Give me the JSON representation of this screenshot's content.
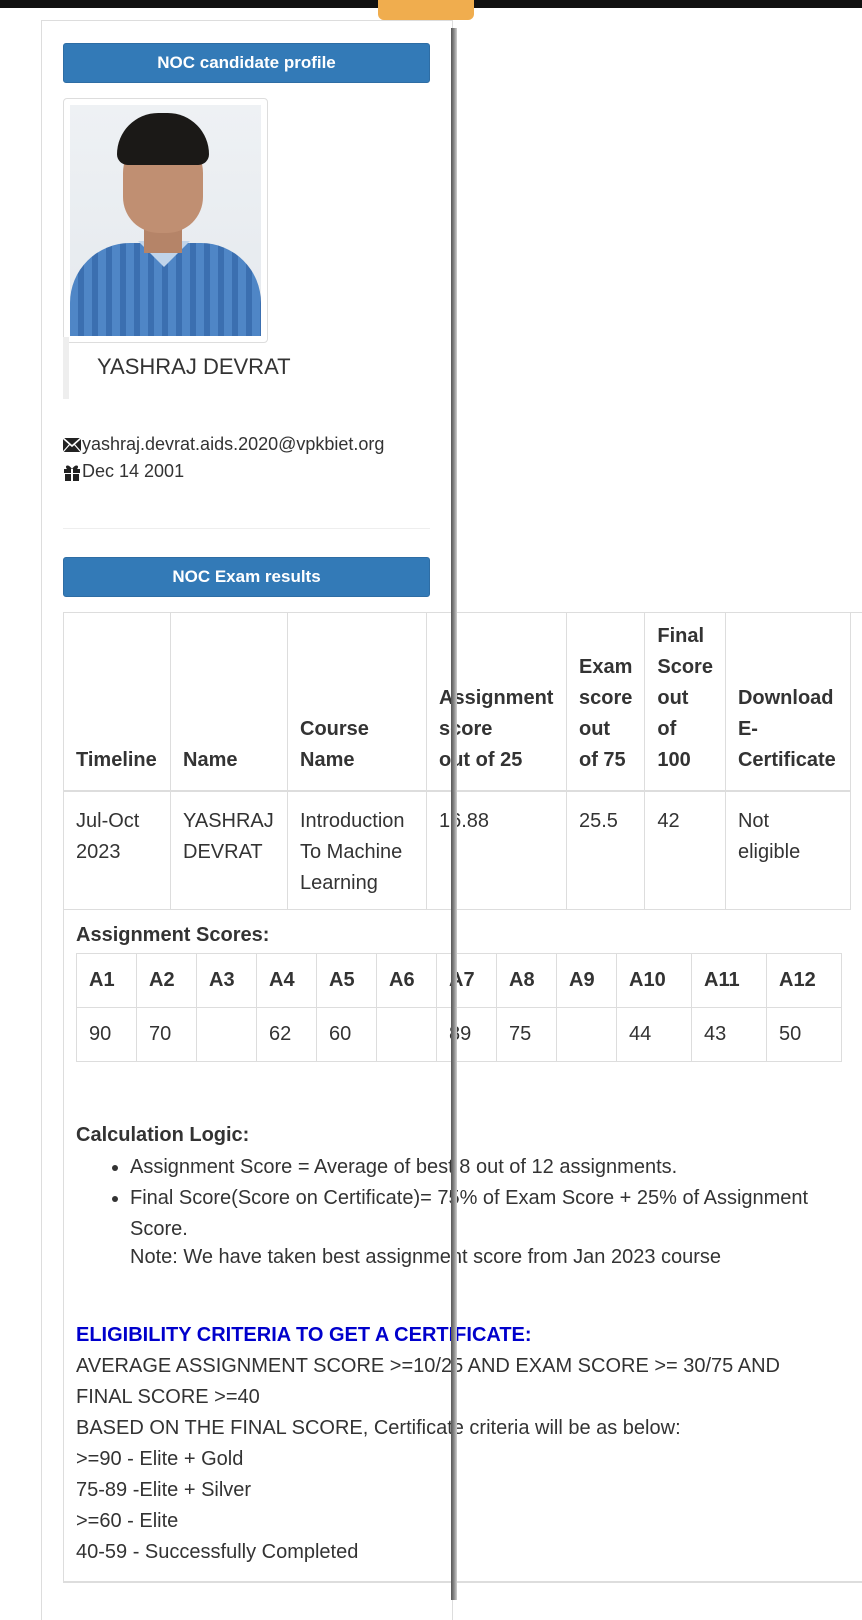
{
  "profile": {
    "header": "NOC candidate profile",
    "name": "YASHRAJ DEVRAT",
    "email": "yashraj.devrat.aids.2020@vpkbiet.org",
    "dob": "Dec 14 2001"
  },
  "results": {
    "header": "NOC Exam results",
    "columns": {
      "timeline": "Timeline",
      "name": "Name",
      "course": [
        "Course",
        "Name"
      ],
      "assignment": [
        "Assignment",
        "score",
        "out of 25"
      ],
      "exam": [
        "Exam",
        "score",
        "out",
        "of 75"
      ],
      "final": [
        "Final",
        "Score",
        "out",
        "of",
        "100"
      ],
      "download": [
        "Download",
        "E-",
        "Certificate"
      ]
    },
    "row": {
      "timeline": [
        "Jul-Oct",
        "2023"
      ],
      "name": [
        "YASHRAJ",
        "DEVRAT"
      ],
      "course": [
        "Introduction",
        "To Machine",
        "Learning"
      ],
      "assignment": "16.88",
      "exam": "25.5",
      "final": "42",
      "download": [
        "Not",
        "eligible"
      ]
    }
  },
  "assignments": {
    "label": "Assignment Scores:",
    "headers": [
      "A1",
      "A2",
      "A3",
      "A4",
      "A5",
      "A6",
      "A7",
      "A8",
      "A9",
      "A10",
      "A11",
      "A12"
    ],
    "scores": [
      "90",
      "70",
      "",
      "62",
      "60",
      "",
      "89",
      "75",
      "",
      "44",
      "43",
      "50"
    ]
  },
  "calculation": {
    "title": "Calculation Logic:",
    "items": [
      "Assignment Score = Average of best 8 out of 12 assignments.",
      "Final Score(Score on Certificate)= 75% of Exam Score + 25% of Assignment Score."
    ],
    "note": "Note: We have taken best assignment score from Jan 2023 course"
  },
  "eligibility": {
    "title": "ELIGIBILITY CRITERIA TO GET A CERTIFICATE:",
    "lines": [
      "AVERAGE ASSIGNMENT SCORE >=10/25 AND EXAM SCORE >= 30/75 AND",
      "FINAL SCORE >=40",
      "BASED ON THE FINAL SCORE, Certificate criteria will be as below:",
      ">=90 - Elite + Gold",
      "75-89 -Elite + Silver",
      ">=60 - Elite",
      "40-59 - Successfully Completed"
    ]
  },
  "colors": {
    "panel_header": "#337ab7",
    "eligibility_title": "#0000cc",
    "top_tab": "#f0ad4e"
  },
  "icons": [
    "envelope-icon",
    "gift-icon"
  ]
}
